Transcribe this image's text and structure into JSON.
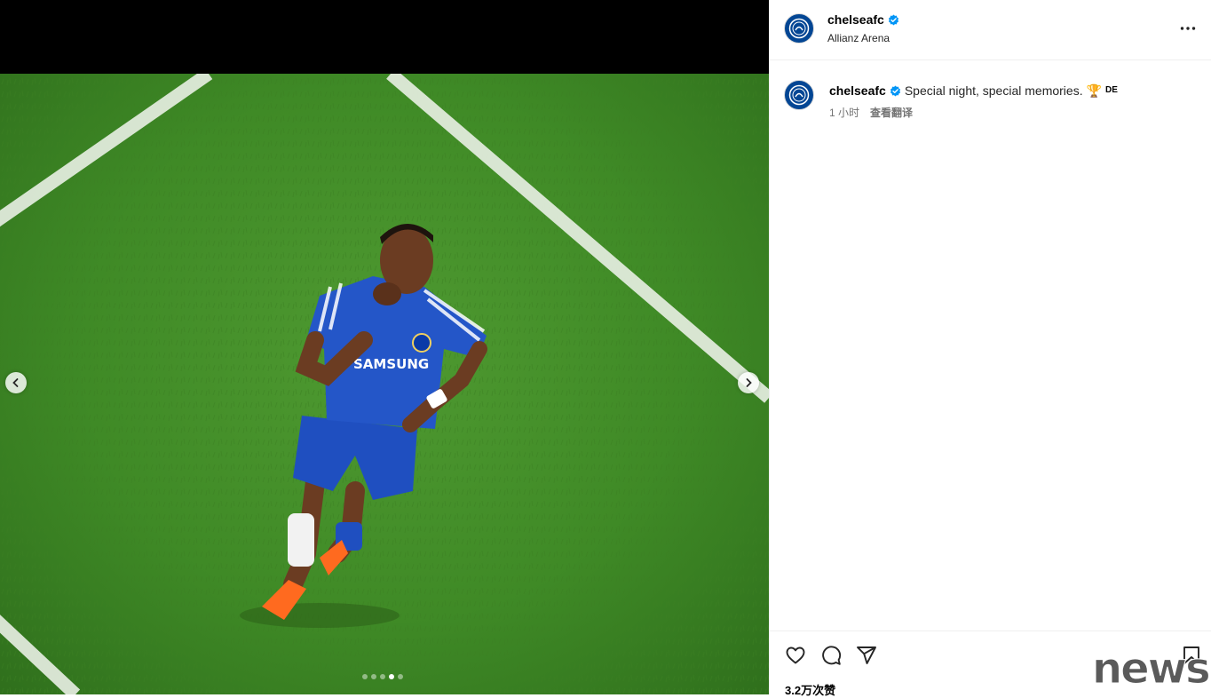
{
  "post": {
    "account": {
      "username": "chelseafc",
      "verified": true,
      "location": "Allianz Arena",
      "avatar_color": "#034694"
    },
    "caption": {
      "username": "chelseafc",
      "text": "Special night, special memories.",
      "emoji": "🏆",
      "trailing": "DE"
    },
    "meta": {
      "time_ago": "1 小时",
      "translate_label": "查看翻译"
    },
    "likes_label": "3.2万次赞",
    "carousel": {
      "slide_count": 5,
      "active_index": 3
    }
  },
  "icons": {
    "verified": "verified-badge-icon",
    "more": "more-options-icon",
    "like": "heart-icon",
    "comment": "comment-icon",
    "share": "share-icon",
    "save": "bookmark-icon",
    "prev": "chevron-left-icon",
    "next": "chevron-right-icon"
  },
  "colors": {
    "verified": "#0095f6",
    "kit_blue": "#1f4fc0",
    "pitch_green": "#4a9530"
  },
  "watermark": "news"
}
